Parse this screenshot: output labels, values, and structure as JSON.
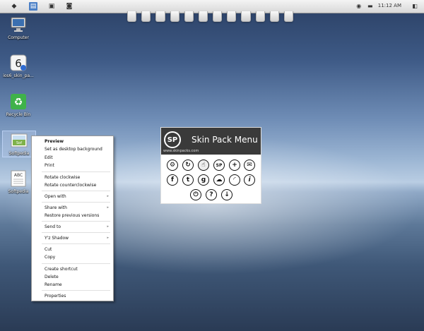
{
  "taskbar": {
    "clock": "11:12 AM",
    "dock_tiles": 12
  },
  "desktop_icons": [
    {
      "label": "Computer",
      "icon": "monitor-icon"
    },
    {
      "label": "ios6_skin_pa...",
      "icon": "installer-icon"
    },
    {
      "label": "Recycle Bin",
      "icon": "recycle-bin-icon"
    },
    {
      "label": "Softpedia",
      "icon": "image-file-icon"
    },
    {
      "label": "Softpedia",
      "icon": "text-file-icon"
    }
  ],
  "image_file_thumb_text": "Sof",
  "text_file_thumb_text": "ABC",
  "context_menu": {
    "items": [
      "Preview",
      "Set as desktop background",
      "Edit",
      "Print",
      "Rotate clockwise",
      "Rotate counterclockwise",
      "Open with",
      "Share with",
      "Restore previous versions",
      "Send to",
      "Y'z Shadow",
      "Cut",
      "Copy",
      "Create shortcut",
      "Delete",
      "Rename",
      "Properties"
    ]
  },
  "skin_pack_menu": {
    "logo": "SP",
    "title": "Skin Pack Menu",
    "url": "www.skinpacks.com",
    "buttons": [
      {
        "icon": "gear-icon",
        "glyph": "⚙"
      },
      {
        "icon": "refresh-icon",
        "glyph": "↻"
      },
      {
        "icon": "hand-cursor-icon",
        "glyph": "☝"
      },
      {
        "icon": "sp-icon",
        "glyph": "SP"
      },
      {
        "icon": "plus-icon",
        "glyph": "+"
      },
      {
        "icon": "mail-icon",
        "glyph": "✉"
      },
      {
        "icon": "facebook-icon",
        "glyph": "f"
      },
      {
        "icon": "twitter-icon",
        "glyph": "t"
      },
      {
        "icon": "google-icon",
        "glyph": "g"
      },
      {
        "icon": "cloud-icon",
        "glyph": "☁"
      },
      {
        "icon": "rss-icon",
        "glyph": "◜"
      },
      {
        "icon": "info-icon",
        "glyph": "i"
      },
      {
        "icon": "power-icon",
        "glyph": "⏻"
      },
      {
        "icon": "help-icon",
        "glyph": "?"
      },
      {
        "icon": "download-icon",
        "glyph": "↓"
      }
    ]
  }
}
